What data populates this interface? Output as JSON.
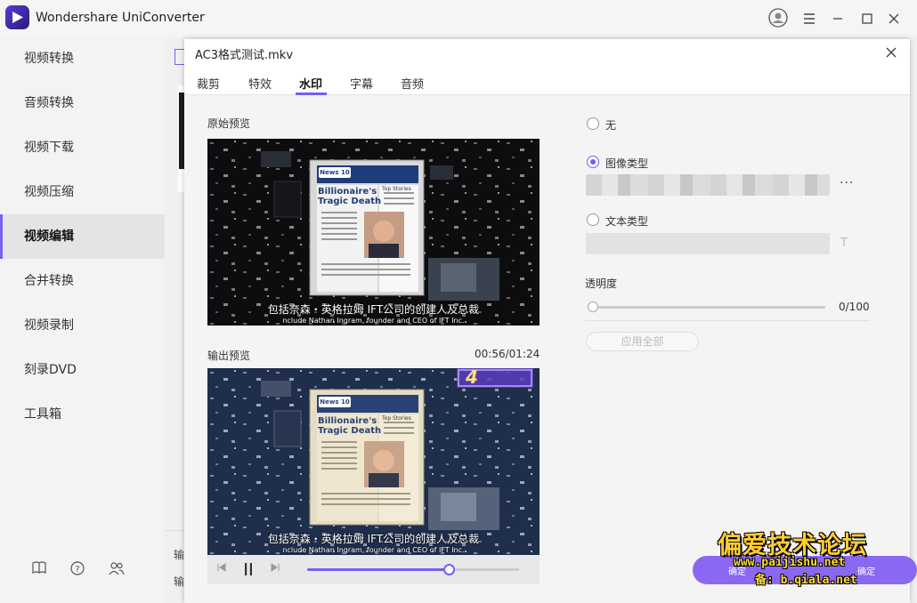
{
  "app": {
    "title": "Wondershare UniConverter"
  },
  "sidebar": {
    "items": [
      {
        "label": "视频转换",
        "active": false
      },
      {
        "label": "音频转换",
        "active": false
      },
      {
        "label": "视频下载",
        "active": false
      },
      {
        "label": "视频压缩",
        "active": false
      },
      {
        "label": "视频编辑",
        "active": true
      },
      {
        "label": "合并转换",
        "active": false
      },
      {
        "label": "视频录制",
        "active": false
      },
      {
        "label": "刻录DVD",
        "active": false
      },
      {
        "label": "工具箱",
        "active": false
      }
    ],
    "bottom_icons": [
      "book-icon",
      "help-icon",
      "users-icon"
    ]
  },
  "behind": {
    "label_a": "输",
    "label_b": "输"
  },
  "dialog": {
    "title": "AC3格式测试.mkv",
    "tabs": [
      {
        "label": "裁剪",
        "active": false
      },
      {
        "label": "特效",
        "active": false
      },
      {
        "label": "水印",
        "active": true
      },
      {
        "label": "字幕",
        "active": false
      },
      {
        "label": "音频",
        "active": false
      }
    ],
    "original_preview": {
      "label": "原始预览"
    },
    "output_preview": {
      "label": "输出预览",
      "timecode": "00:56/01:24",
      "progress": 0.67
    },
    "video": {
      "badge_text": "News 10",
      "headline_1": "Billionaire's",
      "headline_2": "Tragic Death",
      "side_header": "Top Stories",
      "subtitle_cn": "包括奈森・英格拉姆 IFT公司的创建人及总裁",
      "subtitle_en": "nclude Nathan Ingram, founder and CEO of IFT Inc.",
      "overlay_watermark": "4"
    },
    "watermark": {
      "option_none": "无",
      "option_image": "图像类型",
      "option_text": "文本类型",
      "selected": "image",
      "more_label": "···",
      "font_label": "T",
      "opacity_label": "透明度",
      "opacity_value": "0/100",
      "opacity": 0,
      "apply_all": "应用全部"
    }
  },
  "footer": {
    "confirm_left": "确定",
    "confirm_right": "确定"
  },
  "site_watermark": {
    "logo": "偏爱技术论坛",
    "url": "www.paijishu.net",
    "line2": "备: b.qiala.net"
  },
  "colors": {
    "accent": "#7b5cf0",
    "confirm": "#8a68f2"
  }
}
